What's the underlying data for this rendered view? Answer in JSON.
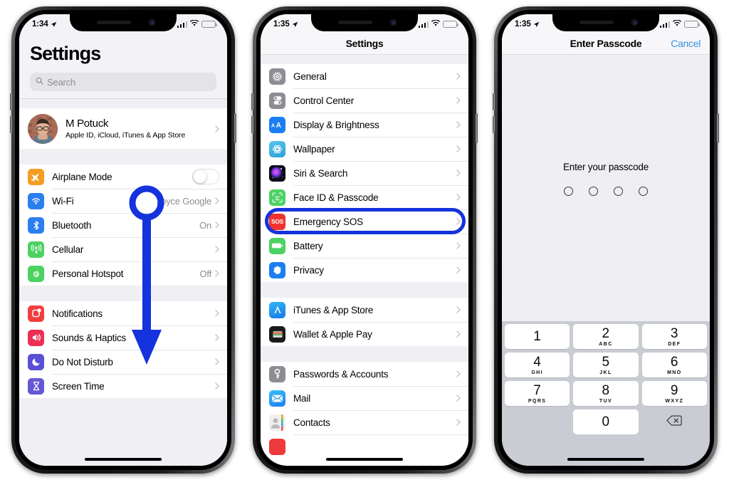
{
  "theme": {
    "accent_blue": "#1433dd",
    "link_blue": "#3a8fe0",
    "screen_bg": "#f2f2f7",
    "keypad_bg": "#c9ccd3"
  },
  "phone1": {
    "status": {
      "time": "1:34",
      "location_icon": "location-arrow-icon",
      "signal_icon": "cellular-bars-icon",
      "wifi_icon": "wifi-icon",
      "battery_icon": "battery-icon"
    },
    "title": "Settings",
    "search": {
      "placeholder": "Search",
      "icon": "search-icon"
    },
    "account": {
      "name": "M Potuck",
      "subtitle": "Apple ID, iCloud, iTunes & App Store",
      "avatar": "user-avatar"
    },
    "groups": [
      {
        "rows": [
          {
            "label": "Airplane Mode",
            "icon": "airplane-icon",
            "value": "",
            "control": "switch",
            "switch_on": false
          },
          {
            "label": "Wi-Fi",
            "icon": "wifi-icon",
            "value": "Joyce Google",
            "control": "chevron"
          },
          {
            "label": "Bluetooth",
            "icon": "bluetooth-icon",
            "value": "On",
            "control": "chevron"
          },
          {
            "label": "Cellular",
            "icon": "cellular-icon",
            "value": "",
            "control": "chevron"
          },
          {
            "label": "Personal Hotspot",
            "icon": "personal-hotspot-icon",
            "value": "Off",
            "control": "chevron"
          }
        ]
      },
      {
        "rows": [
          {
            "label": "Notifications",
            "icon": "notifications-icon",
            "value": "",
            "control": "chevron"
          },
          {
            "label": "Sounds & Haptics",
            "icon": "sounds-haptics-icon",
            "value": "",
            "control": "chevron"
          },
          {
            "label": "Do Not Disturb",
            "icon": "do-not-disturb-icon",
            "value": "",
            "control": "chevron"
          },
          {
            "label": "Screen Time",
            "icon": "screen-time-icon",
            "value": "",
            "control": "chevron"
          }
        ]
      }
    ],
    "annotation": {
      "type": "circle-arrow-down",
      "color": "#1433dd"
    }
  },
  "phone2": {
    "status": {
      "time": "1:35"
    },
    "nav_title": "Settings",
    "groups": [
      {
        "rows": [
          {
            "label": "General",
            "icon": "gear-icon",
            "highlighted": false
          },
          {
            "label": "Control Center",
            "icon": "control-center-icon",
            "highlighted": false
          },
          {
            "label": "Display & Brightness",
            "icon": "display-brightness-icon",
            "highlighted": false
          },
          {
            "label": "Wallpaper",
            "icon": "wallpaper-icon",
            "highlighted": false
          },
          {
            "label": "Siri & Search",
            "icon": "siri-icon",
            "highlighted": false
          },
          {
            "label": "Face ID & Passcode",
            "icon": "face-id-icon",
            "highlighted": true
          },
          {
            "label": "Emergency SOS",
            "icon": "emergency-sos-icon",
            "highlighted": false
          },
          {
            "label": "Battery",
            "icon": "battery-icon",
            "highlighted": false
          },
          {
            "label": "Privacy",
            "icon": "privacy-hand-icon",
            "highlighted": false
          }
        ]
      },
      {
        "rows": [
          {
            "label": "iTunes & App Store",
            "icon": "app-store-icon",
            "highlighted": false
          },
          {
            "label": "Wallet & Apple Pay",
            "icon": "wallet-icon",
            "highlighted": false
          }
        ]
      },
      {
        "rows": [
          {
            "label": "Passwords & Accounts",
            "icon": "key-icon",
            "highlighted": false
          },
          {
            "label": "Mail",
            "icon": "mail-icon",
            "highlighted": false
          },
          {
            "label": "Contacts",
            "icon": "contacts-icon",
            "highlighted": false
          }
        ]
      }
    ]
  },
  "phone3": {
    "status": {
      "time": "1:35"
    },
    "nav_title": "Enter Passcode",
    "cancel_label": "Cancel",
    "prompt": "Enter your passcode",
    "passcode_dots": 4,
    "passcode_entered": 0,
    "keypad": [
      {
        "num": "1",
        "letters": ""
      },
      {
        "num": "2",
        "letters": "ABC"
      },
      {
        "num": "3",
        "letters": "DEF"
      },
      {
        "num": "4",
        "letters": "GHI"
      },
      {
        "num": "5",
        "letters": "JKL"
      },
      {
        "num": "6",
        "letters": "MNO"
      },
      {
        "num": "7",
        "letters": "PQRS"
      },
      {
        "num": "8",
        "letters": "TUV"
      },
      {
        "num": "9",
        "letters": "WXYZ"
      },
      {
        "num": "",
        "letters": ""
      },
      {
        "num": "0",
        "letters": ""
      },
      {
        "num": "",
        "letters": "",
        "icon": "delete-backspace-icon"
      }
    ]
  }
}
